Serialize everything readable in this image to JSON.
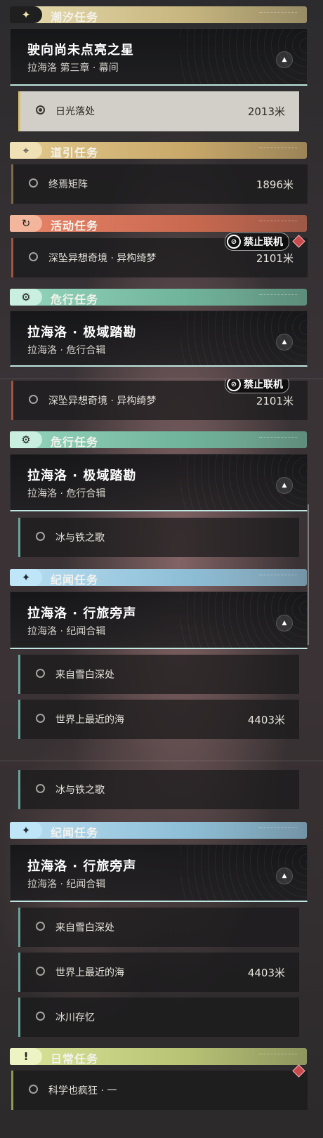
{
  "categories": {
    "tide": {
      "label": "潮汐任务",
      "icon": "sparkle-icon",
      "color": "#e6d8a0"
    },
    "guide": {
      "label": "道引任务",
      "icon": "map-pin-icon",
      "color": "#d7b774"
    },
    "event": {
      "label": "活动任务",
      "icon": "refresh-icon",
      "color": "#e0765a"
    },
    "danger": {
      "label": "危行任务",
      "icon": "gear-eye-icon",
      "color": "#8ccfb4"
    },
    "chronicle": {
      "label": "纪闻任务",
      "icon": "sparkle-icon",
      "color": "#a9d6ee"
    },
    "daily": {
      "label": "日常任务",
      "icon": "alert-box-icon",
      "color": "#d8e28f"
    }
  },
  "panel1": {
    "tide_chain": {
      "title": "驶向尚未点亮之星",
      "subtitle": "拉海洛 第三章 · 幕间"
    },
    "tide_item": {
      "name": "日光落处",
      "distance": "2013米"
    },
    "guide_item": {
      "name": "终焉矩阵",
      "distance": "1896米"
    },
    "event_item": {
      "name": "深坠异想奇境 · 异构绮梦",
      "distance": "2101米"
    },
    "danger_chain": {
      "title": "拉海洛 · 极域踏勘",
      "subtitle": "拉海洛 · 危行合辑"
    }
  },
  "panel2": {
    "event_item": {
      "name": "深坠异想奇境 · 异构绮梦",
      "distance": "2101米"
    },
    "danger_chain": {
      "title": "拉海洛 · 极域踏勘",
      "subtitle": "拉海洛 · 危行合辑"
    },
    "danger_item": {
      "name": "冰与铁之歌"
    },
    "chronicle_chain": {
      "title": "拉海洛 · 行旅旁声",
      "subtitle": "拉海洛 · 纪闻合辑"
    },
    "chronicle_items": [
      {
        "name": "来自雪白深处"
      },
      {
        "name": "世界上最近的海",
        "distance": "4403米"
      }
    ]
  },
  "panel3": {
    "danger_item": {
      "name": "冰与铁之歌"
    },
    "chronicle_chain": {
      "title": "拉海洛 · 行旅旁声",
      "subtitle": "拉海洛 · 纪闻合辑"
    },
    "chronicle_items": [
      {
        "name": "来自雪白深处"
      },
      {
        "name": "世界上最近的海",
        "distance": "4403米"
      },
      {
        "name": "冰川存忆"
      }
    ],
    "daily_item": {
      "name": "科学也疯狂 · 一"
    }
  },
  "tags": {
    "no_coop": "禁止联机"
  }
}
